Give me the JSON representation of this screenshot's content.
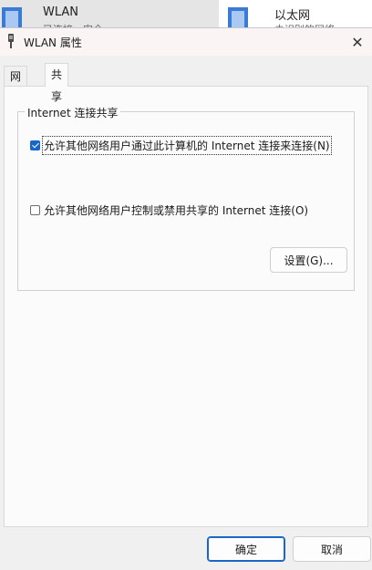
{
  "background": {
    "items": [
      {
        "name": "WLAN",
        "sub": "已连接，安全"
      },
      {
        "name": "以太网",
        "sub": "未识别的网络"
      }
    ]
  },
  "dialog": {
    "title": "WLAN 属性",
    "close_glyph": "✕",
    "tabs": [
      {
        "label": "网络"
      },
      {
        "label": "共享"
      }
    ],
    "active_tab": "共享",
    "group": {
      "title": "Internet 连接共享",
      "allow_share": {
        "label": "允许其他网络用户通过此计算机的 Internet 连接来连接(N)",
        "checked": true
      },
      "allow_control": {
        "label": "允许其他网络用户控制或禁用共享的 Internet 连接(O)",
        "checked": false
      },
      "settings_button": "设置(G)..."
    },
    "ok_button": "确定",
    "cancel_button": "取消"
  },
  "colors": {
    "accent": "#1866c9",
    "title_bg": "#fbf4f4"
  }
}
